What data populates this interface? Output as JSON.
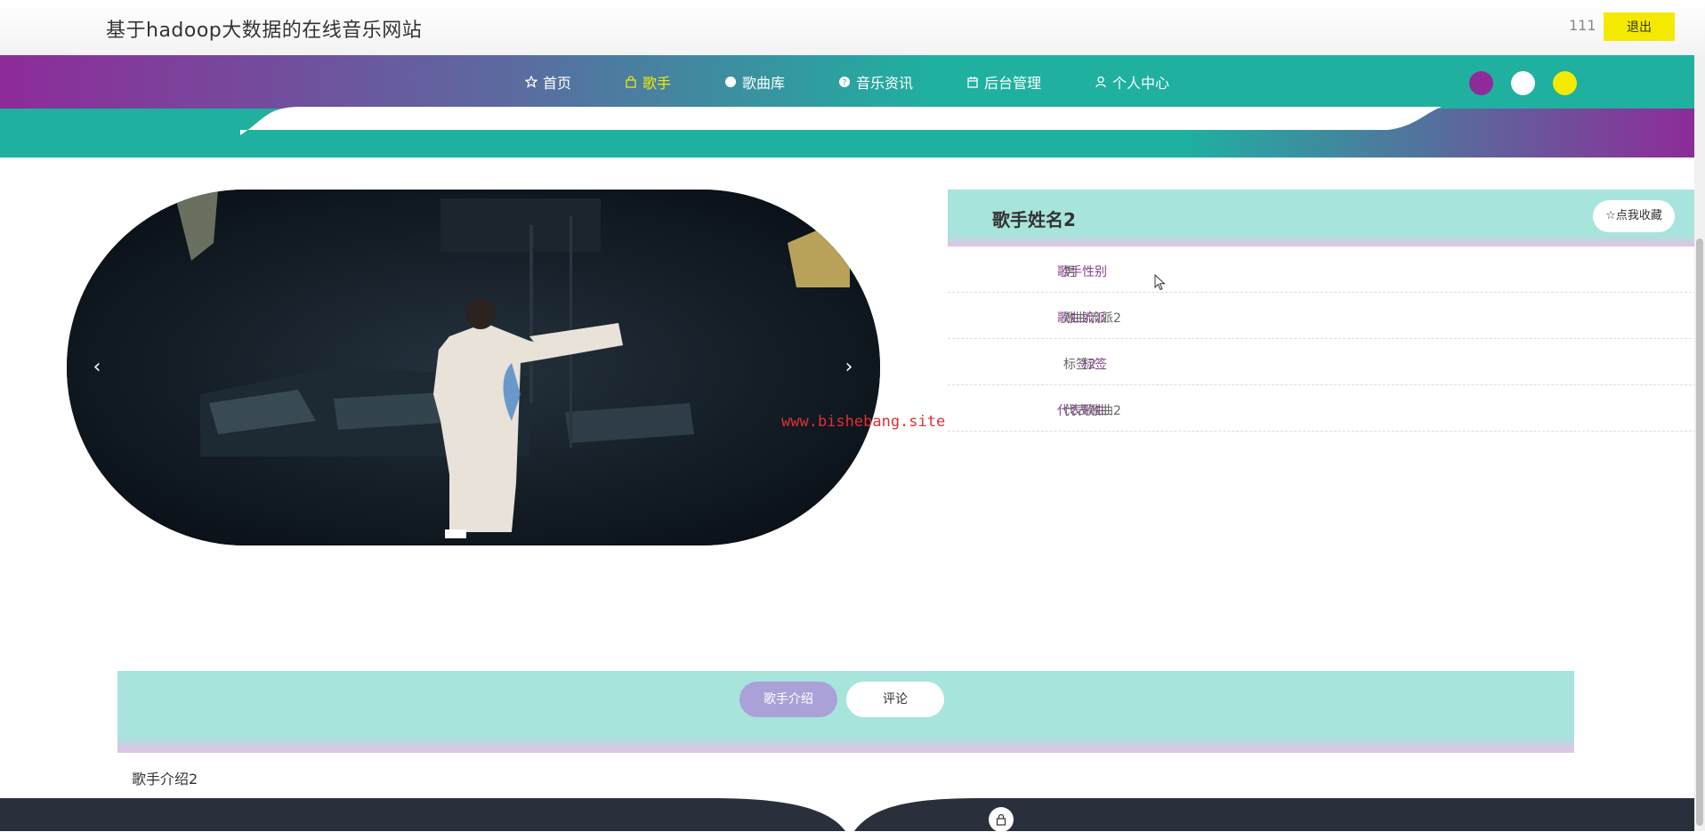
{
  "header": {
    "site_title": "基于hadoop大数据的在线音乐网站",
    "username": "111",
    "logout_label": "退出"
  },
  "nav": {
    "items": [
      {
        "label": "首页",
        "icon": "star-icon",
        "active": false
      },
      {
        "label": "歌手",
        "icon": "bag-icon",
        "active": true
      },
      {
        "label": "歌曲库",
        "icon": "circle-icon",
        "active": false
      },
      {
        "label": "音乐资讯",
        "icon": "question-icon",
        "active": false
      },
      {
        "label": "后台管理",
        "icon": "calendar-icon",
        "active": false
      },
      {
        "label": "个人中心",
        "icon": "user-icon",
        "active": false
      }
    ],
    "theme_colors": [
      "#8e2b99",
      "#ffffff",
      "#f4ea00"
    ],
    "gradient_colors": [
      "#8e2b99",
      "#1fb0a0"
    ]
  },
  "carousel": {
    "prev_label": "‹",
    "next_label": "›"
  },
  "watermark": "www.bishebang.site",
  "singer": {
    "name": "歌手姓名2",
    "fav_label": "点我收藏",
    "fields": [
      {
        "label": "歌手性别",
        "value": "男"
      },
      {
        "label": "歌曲流派",
        "value": "歌曲流派2"
      },
      {
        "label": "标签",
        "value": "标签2"
      },
      {
        "label": "代表歌曲",
        "value": "代表歌曲2"
      }
    ]
  },
  "tabs": {
    "intro_label": "歌手介绍",
    "comment_label": "评论"
  },
  "intro_text": "歌手介绍2"
}
